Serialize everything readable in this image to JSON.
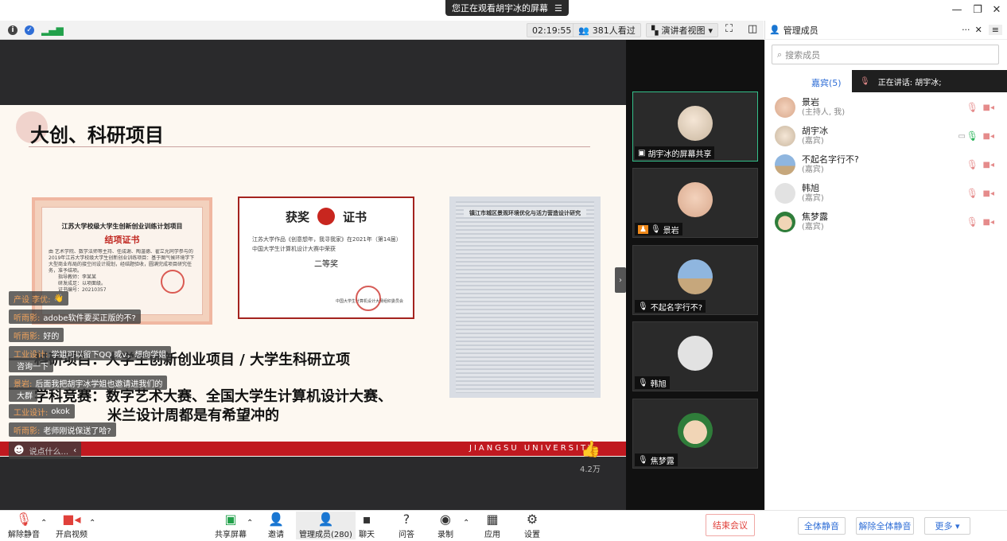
{
  "window": {
    "banner_text": "您正在观看胡宇冰的屏幕",
    "banner_icon": "menu-lines-icon",
    "controls": [
      "minimize-icon",
      "restore-icon",
      "close-icon"
    ]
  },
  "toolbar": {
    "timer": "02:19:55",
    "viewers": "381人看过",
    "view_mode": "演讲者视图"
  },
  "slide": {
    "title": "大创、科研项目",
    "cert1": {
      "heading": "江苏大学校级大学生创新创业训练计划项目",
      "subheading": "结项证书",
      "body": "由 艺术学院、数学法师等主持、任成谢、陶温德、翟立允同学参与的2019年江苏大学校级大学生创新创业训练项目：基于图气候环境学下大型商业布局的接空间设计规划，经结题验收，圆满完成项目研究任务，准予结项。",
      "lines": [
        "指导教师：李某某",
        "研发成足：以项面级。",
        "证书编号：20210357"
      ]
    },
    "cert2": {
      "heading_left": "获奖",
      "heading_right": "证书",
      "body": "江苏大学作品《创意想年，我寻我家》在2021年（第14届）中国大学生计算机设计大赛中荣获",
      "award": "二等奖",
      "footer": "中国大学生计算机设计大赛组织委员会"
    },
    "cert3": {
      "heading": "镇江市城区景观环境优化与活力营造设计研究"
    },
    "text_line1": "科研项目：大学生创新创业项目 / 大学生科研立项",
    "text_line2": "学科竞赛：数字艺术大赛、全国大学生计算机设计大赛、",
    "text_line3": "米兰设计周都是有希望冲的",
    "footer_brand": "JIANGSU UNIVERSITY",
    "likes": "4.2万"
  },
  "chat": [
    {
      "who": "产设 李优:",
      "msg": "👋"
    },
    {
      "who": "听雨影:",
      "msg": "adobe软件要买正版的不?"
    },
    {
      "who": "听雨影:",
      "msg": "好的"
    },
    {
      "who": "工业设计:",
      "msg": "学姐可以留下QQ 或v，想向学姐"
    },
    {
      "who": "",
      "msg": "咨询一下"
    },
    {
      "who": "景岩:",
      "msg": "后面我把胡宇冰学姐也邀请进我们的"
    },
    {
      "who": "",
      "msg": "大群"
    },
    {
      "who": "工业设计:",
      "msg": "okok"
    },
    {
      "who": "听雨影:",
      "msg": "老师刚说保送了哈?"
    }
  ],
  "chat_input": {
    "placeholder": "说点什么..."
  },
  "tiles": [
    {
      "name": "胡宇冰的屏幕共享",
      "icon": "screen-share-icon",
      "active": true
    },
    {
      "name": "景岩",
      "icon": "mic-muted-icon"
    },
    {
      "name": "不起名字行不?",
      "icon": "mic-muted-icon"
    },
    {
      "name": "韩旭",
      "icon": "mic-muted-icon"
    },
    {
      "name": "焦梦露",
      "icon": "mic-muted-icon"
    }
  ],
  "panel": {
    "title": "管理成员",
    "search_placeholder": "搜索成员",
    "tab_guests": "嘉宾(5)",
    "speaking": "正在讲话: 胡宇冰;",
    "members": [
      {
        "name": "景岩",
        "role": "(主持人, 我)"
      },
      {
        "name": "胡宇冰",
        "role": "(嘉宾)"
      },
      {
        "name": "不起名字行不?",
        "role": "(嘉宾)"
      },
      {
        "name": "韩旭",
        "role": "(嘉宾)"
      },
      {
        "name": "焦梦露",
        "role": "(嘉宾)"
      }
    ],
    "mute_all": "全体静音",
    "unmute_all": "解除全体静音",
    "more": "更多 ▾"
  },
  "bottom": {
    "unmute": "解除静音",
    "start_video": "开启视频",
    "share_screen": "共享屏幕",
    "invite": "邀请",
    "manage_members": "管理成员(280)",
    "chat": "聊天",
    "qa": "问答",
    "record": "录制",
    "apps": "应用",
    "settings": "设置",
    "end_meeting": "结束会议"
  },
  "colors": {
    "accent": "#2f6ed6",
    "danger": "#e0403a",
    "slide_red": "#c01920",
    "active_tile": "#33c08a"
  }
}
